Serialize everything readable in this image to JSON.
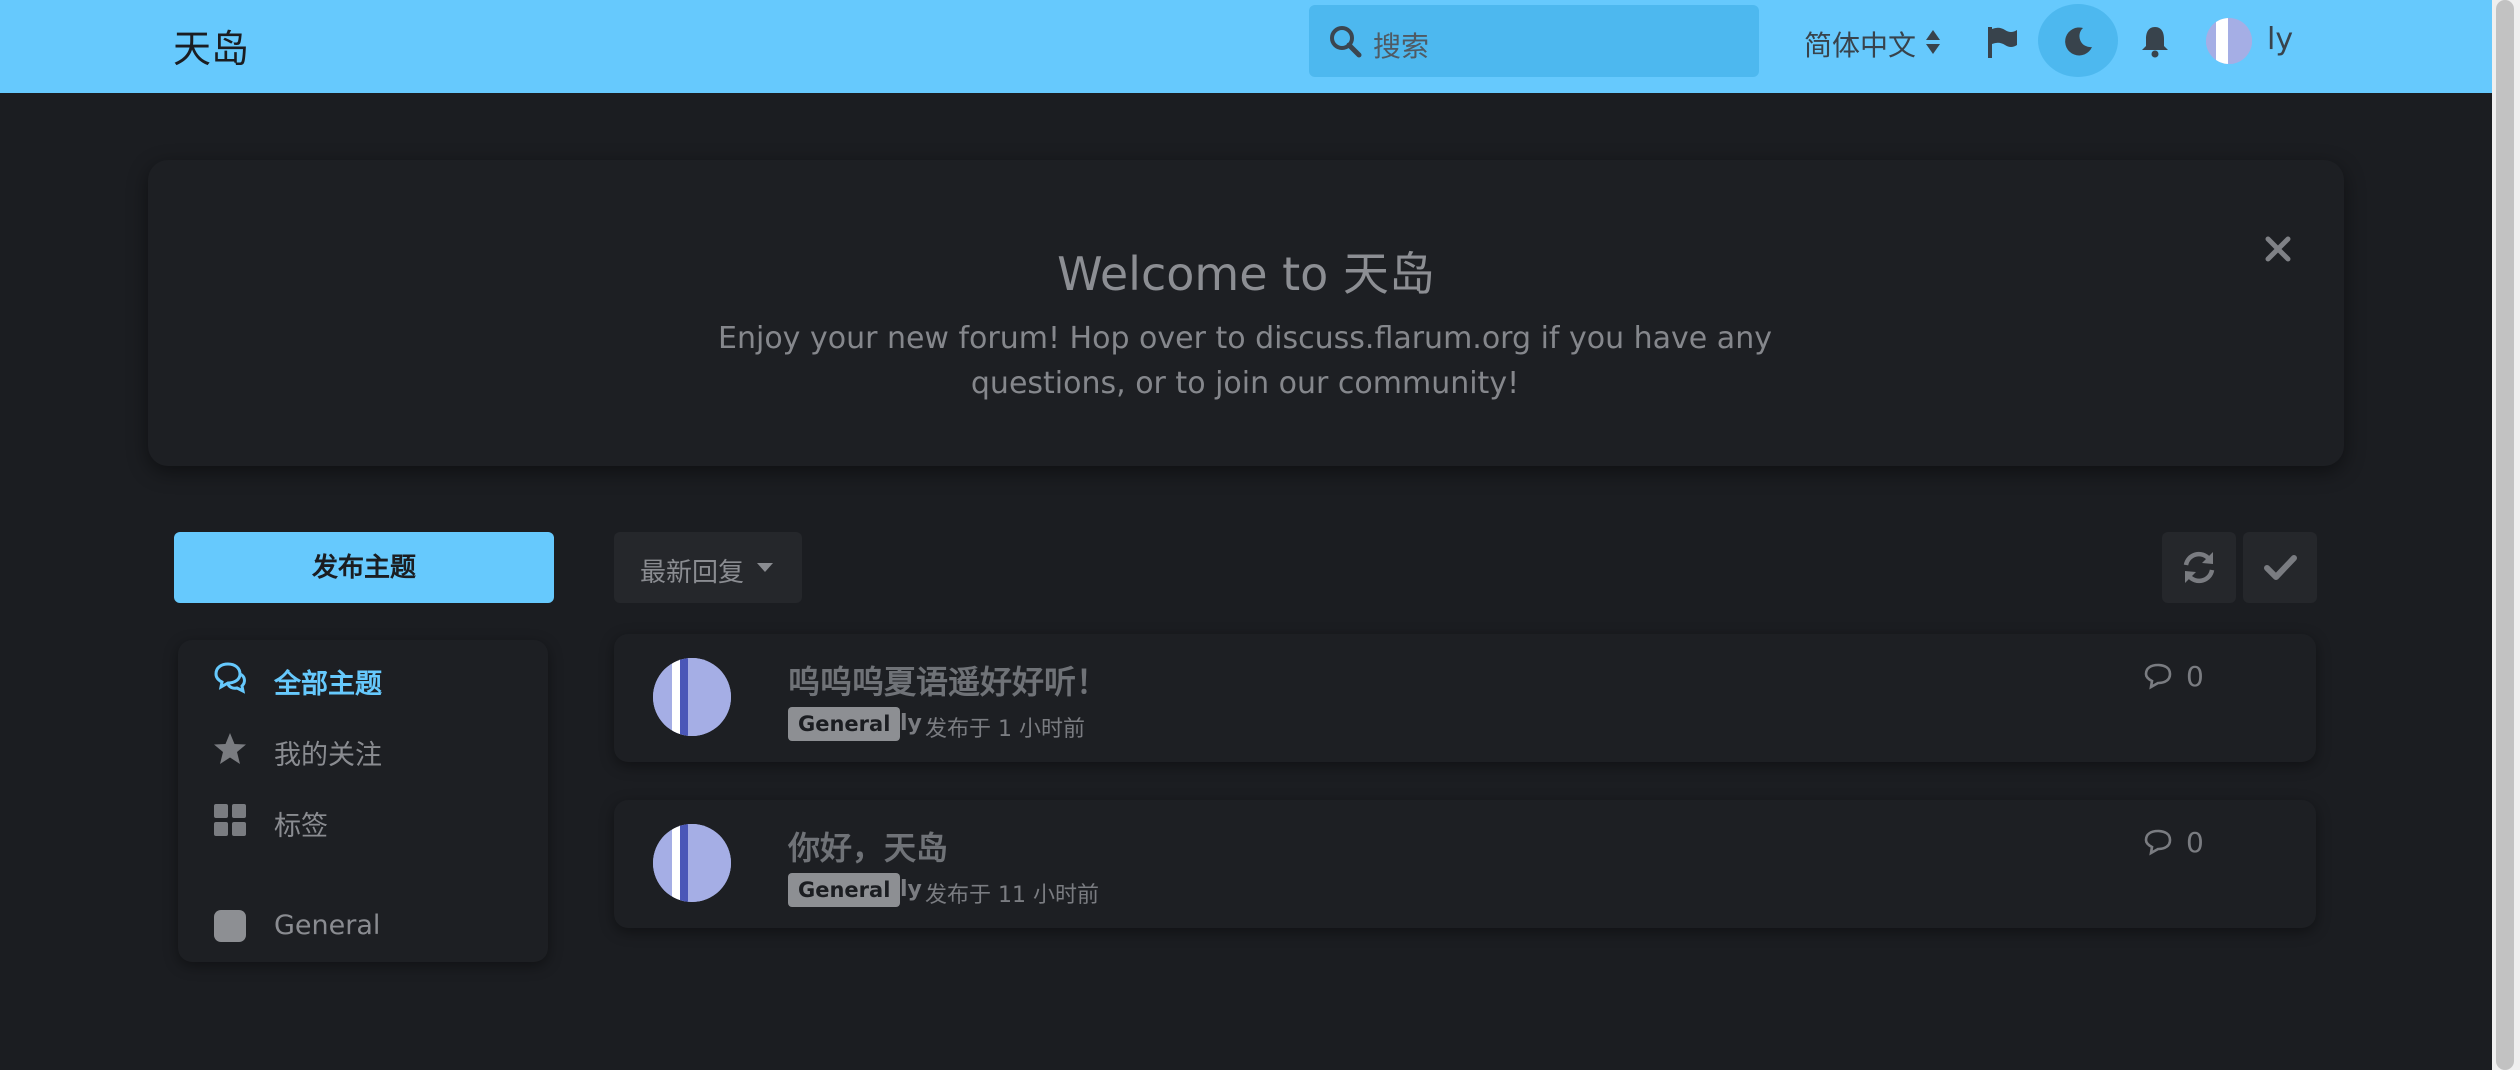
{
  "header": {
    "site_title": "天岛",
    "search_placeholder": "搜索",
    "language": "简体中文",
    "user_name": "ly"
  },
  "hero": {
    "title": "Welcome to 天岛",
    "text": "Enjoy your new forum! Hop over to discuss.flarum.org if you have any questions, or to join our community!"
  },
  "sidebar": {
    "start_button": "发布主题",
    "nav": [
      {
        "label": "全部主题",
        "icon": "comments-icon",
        "active": true
      },
      {
        "label": "我的关注",
        "icon": "star-icon",
        "active": false
      },
      {
        "label": "标签",
        "icon": "grid-icon",
        "active": false
      },
      {
        "label": "General",
        "icon": "tag-color-icon",
        "active": false
      }
    ]
  },
  "toolbar": {
    "sort_label": "最新回复"
  },
  "discussions": [
    {
      "title": "呜呜呜夏语遥好好听！",
      "tag": "General",
      "user": "ly",
      "time": "发布于 1 小时前",
      "replies": "0"
    },
    {
      "title": "你好，天岛",
      "tag": "General",
      "user": "ly",
      "time": "发布于 11 小时前",
      "replies": "0"
    }
  ],
  "colors": {
    "header_bg": "#66c9fd",
    "page_bg": "#1b1d21",
    "panel_bg": "#1d1f23",
    "avatar_color": "#a5aee5",
    "tag_bg": "#8d8f93"
  }
}
